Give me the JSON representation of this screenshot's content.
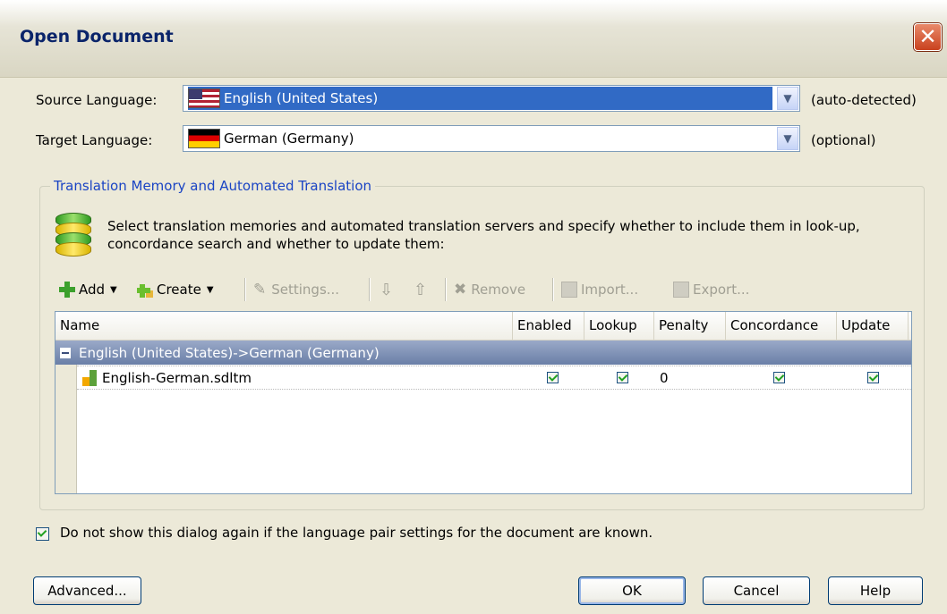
{
  "window": {
    "title": "Open Document",
    "close_glyph": "✕"
  },
  "source": {
    "label": "Source Language:",
    "value": "English (United States)",
    "note": "(auto-detected)"
  },
  "target": {
    "label": "Target Language:",
    "value": "German (Germany)",
    "note": "(optional)"
  },
  "tm_group": {
    "title": "Translation Memory and Automated Translation",
    "description": "Select translation memories and automated translation servers and specify whether to include them in look-up, concordance search and whether to update them:"
  },
  "toolbar": {
    "add": "Add",
    "create": "Create",
    "settings": "Settings...",
    "remove": "Remove",
    "import": "Import...",
    "export": "Export...",
    "down_glyph": "⇩",
    "up_glyph": "⇧",
    "remove_glyph": "✖",
    "settings_glyph": "✎"
  },
  "grid": {
    "columns": [
      "Name",
      "Enabled",
      "Lookup",
      "Penalty",
      "Concordance",
      "Update"
    ],
    "group": "English (United States)->German (Germany)",
    "rows": [
      {
        "name": "English-German.sdltm",
        "enabled": true,
        "lookup": true,
        "penalty": "0",
        "concordance": true,
        "update": true
      }
    ]
  },
  "footer": {
    "checkbox_label": "Do not show this dialog again if the language pair settings for the document are known.",
    "checkbox_checked": true,
    "advanced": "Advanced...",
    "ok": "OK",
    "cancel": "Cancel",
    "help": "Help"
  },
  "colors": {
    "selection": "#316ac5",
    "group_title": "#1a44c4",
    "title": "#0a246a"
  }
}
